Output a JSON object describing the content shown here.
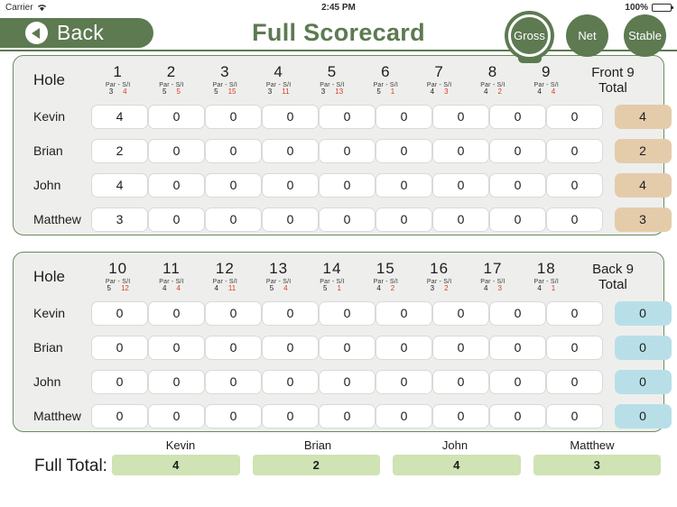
{
  "statusbar": {
    "carrier": "Carrier",
    "wifi_icon": "wifi-icon",
    "time": "2:45 PM",
    "battery_percent": "100%",
    "battery_icon": "battery-full-icon"
  },
  "header": {
    "back_label": "Back",
    "back_icon": "back-arrow-icon",
    "title": "Full Scorecard",
    "modes": [
      {
        "label": "Gross",
        "selected": true
      },
      {
        "label": "Net",
        "selected": false
      },
      {
        "label": "Stable",
        "selected": false
      }
    ]
  },
  "labels": {
    "hole": "Hole",
    "par_si": "Par  -  S/I",
    "front_total": "Front 9\nTotal",
    "front_total_line1": "Front 9",
    "front_total_line2": "Total",
    "back_total_line1": "Back 9",
    "back_total_line2": "Total",
    "full_total": "Full Total:"
  },
  "front_nine": {
    "holes": [
      {
        "number": "1",
        "par": "3",
        "si": "4"
      },
      {
        "number": "2",
        "par": "5",
        "si": "5"
      },
      {
        "number": "3",
        "par": "5",
        "si": "15"
      },
      {
        "number": "4",
        "par": "3",
        "si": "11"
      },
      {
        "number": "5",
        "par": "3",
        "si": "13"
      },
      {
        "number": "6",
        "par": "5",
        "si": "1"
      },
      {
        "number": "7",
        "par": "4",
        "si": "3"
      },
      {
        "number": "8",
        "par": "4",
        "si": "2"
      },
      {
        "number": "9",
        "par": "4",
        "si": "4"
      }
    ],
    "rows": [
      {
        "player": "Kevin",
        "scores": [
          "4",
          "0",
          "0",
          "0",
          "0",
          "0",
          "0",
          "0",
          "0"
        ],
        "total": "4"
      },
      {
        "player": "Brian",
        "scores": [
          "2",
          "0",
          "0",
          "0",
          "0",
          "0",
          "0",
          "0",
          "0"
        ],
        "total": "2"
      },
      {
        "player": "John",
        "scores": [
          "4",
          "0",
          "0",
          "0",
          "0",
          "0",
          "0",
          "0",
          "0"
        ],
        "total": "4"
      },
      {
        "player": "Matthew",
        "scores": [
          "3",
          "0",
          "0",
          "0",
          "0",
          "0",
          "0",
          "0",
          "0"
        ],
        "total": "3"
      }
    ]
  },
  "back_nine": {
    "holes": [
      {
        "number": "10",
        "par": "5",
        "si": "12"
      },
      {
        "number": "11",
        "par": "4",
        "si": "4"
      },
      {
        "number": "12",
        "par": "4",
        "si": "11"
      },
      {
        "number": "13",
        "par": "5",
        "si": "4"
      },
      {
        "number": "14",
        "par": "5",
        "si": "1"
      },
      {
        "number": "15",
        "par": "4",
        "si": "2"
      },
      {
        "number": "16",
        "par": "3",
        "si": "2"
      },
      {
        "number": "17",
        "par": "4",
        "si": "3"
      },
      {
        "number": "18",
        "par": "4",
        "si": "1"
      }
    ],
    "rows": [
      {
        "player": "Kevin",
        "scores": [
          "0",
          "0",
          "0",
          "0",
          "0",
          "0",
          "0",
          "0",
          "0"
        ],
        "total": "0"
      },
      {
        "player": "Brian",
        "scores": [
          "0",
          "0",
          "0",
          "0",
          "0",
          "0",
          "0",
          "0",
          "0"
        ],
        "total": "0"
      },
      {
        "player": "John",
        "scores": [
          "0",
          "0",
          "0",
          "0",
          "0",
          "0",
          "0",
          "0",
          "0"
        ],
        "total": "0"
      },
      {
        "player": "Matthew",
        "scores": [
          "0",
          "0",
          "0",
          "0",
          "0",
          "0",
          "0",
          "0",
          "0"
        ],
        "total": "0"
      }
    ]
  },
  "full_total": {
    "players": [
      "Kevin",
      "Brian",
      "John",
      "Matthew"
    ],
    "values": [
      "4",
      "2",
      "4",
      "3"
    ]
  },
  "colors": {
    "brand_green": "#5d7a51",
    "panel_bg": "#eeefed",
    "panel_border": "#6c8a5f",
    "front_total_bg": "#e4ccab",
    "back_total_bg": "#b8dfe8",
    "full_total_bg": "#cfe3b4",
    "si_red": "#e03a20"
  }
}
